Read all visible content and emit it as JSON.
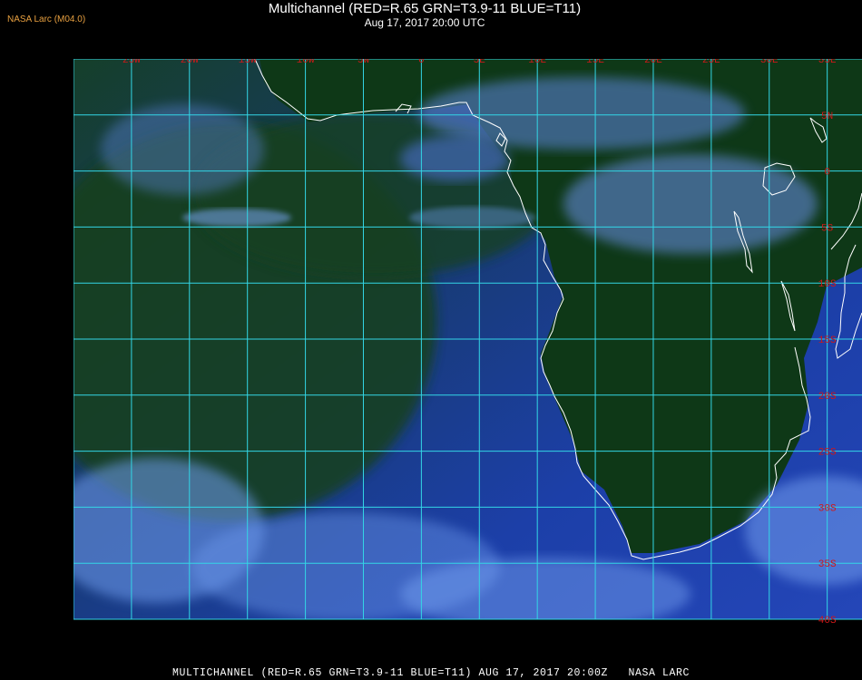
{
  "header": {
    "credit": "NASA Larc (M04.0)",
    "title": "Multichannel (RED=R.65 GRN=T3.9-11 BLUE=T11)",
    "subtitle": "Aug 17, 2017 20:00 UTC"
  },
  "footer": {
    "caption": "MULTICHANNEL (RED=R.65 GRN=T3.9-11 BLUE=T11) AUG 17, 2017 20:00Z   NASA LARC"
  },
  "map": {
    "lon_range": [
      -30,
      38
    ],
    "lat_range": [
      -40,
      10
    ],
    "lon_lines": [
      -25,
      -20,
      -15,
      -10,
      -5,
      0,
      5,
      10,
      15,
      20,
      25,
      30,
      35
    ],
    "lat_lines": [
      5,
      0,
      -5,
      -10,
      -15,
      -20,
      -25,
      -30,
      -35,
      -40
    ],
    "lon_labels": [
      "25W",
      "20W",
      "15W",
      "10W",
      "5W",
      "0",
      "5E",
      "10E",
      "15E",
      "20E",
      "25E",
      "30E",
      "35E"
    ],
    "lat_labels": [
      "5N",
      "0",
      "5S",
      "10S",
      "15S",
      "20S",
      "25S",
      "30S",
      "35S",
      "40S"
    ],
    "colors": {
      "grid": "#33d6e6",
      "label": "#d01818",
      "coast": "#ffffff",
      "ocean": "#1c3aa0",
      "land": "#0f3a18",
      "cloud": "#6f9df0"
    }
  }
}
